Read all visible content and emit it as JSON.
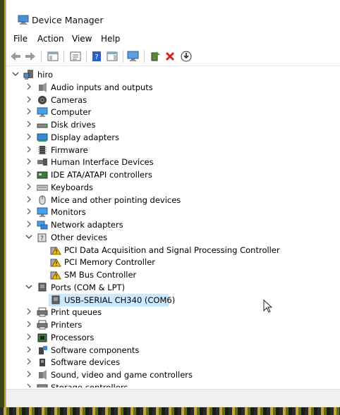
{
  "window": {
    "title": "Device Manager"
  },
  "menu": [
    "File",
    "Action",
    "View",
    "Help"
  ],
  "tree": {
    "root": "hiro",
    "rows": [
      {
        "label": "Audio inputs and outputs",
        "icon": "speaker-icon",
        "state": "collapsed"
      },
      {
        "label": "Cameras",
        "icon": "camera-icon",
        "state": "collapsed"
      },
      {
        "label": "Computer",
        "icon": "monitor-icon",
        "state": "collapsed"
      },
      {
        "label": "Disk drives",
        "icon": "disk-icon",
        "state": "collapsed"
      },
      {
        "label": "Display adapters",
        "icon": "display-adapter-icon",
        "state": "collapsed"
      },
      {
        "label": "Firmware",
        "icon": "firmware-icon",
        "state": "collapsed"
      },
      {
        "label": "Human Interface Devices",
        "icon": "hid-icon",
        "state": "collapsed"
      },
      {
        "label": "IDE ATA/ATAPI controllers",
        "icon": "ide-controller-icon",
        "state": "collapsed"
      },
      {
        "label": "Keyboards",
        "icon": "keyboard-icon",
        "state": "collapsed"
      },
      {
        "label": "Mice and other pointing devices",
        "icon": "mouse-icon",
        "state": "collapsed"
      },
      {
        "label": "Monitors",
        "icon": "monitor-icon",
        "state": "collapsed"
      },
      {
        "label": "Network adapters",
        "icon": "network-icon",
        "state": "collapsed"
      },
      {
        "label": "Other devices",
        "icon": "unknown-device-icon",
        "state": "expanded"
      },
      {
        "label": "PCI Data Acquisition and Signal Processing Controller",
        "icon": "warning-device-icon",
        "child": true
      },
      {
        "label": "PCI Memory Controller",
        "icon": "warning-device-icon",
        "child": true
      },
      {
        "label": "SM Bus Controller",
        "icon": "warning-device-icon",
        "child": true
      },
      {
        "label": "Ports (COM & LPT)",
        "icon": "port-icon",
        "state": "expanded"
      },
      {
        "label": "USB-SERIAL CH340 (COM6)",
        "icon": "port-icon",
        "child": true,
        "selected": true
      },
      {
        "label": "Print queues",
        "icon": "printer-icon",
        "state": "collapsed"
      },
      {
        "label": "Printers",
        "icon": "printer-icon",
        "state": "collapsed"
      },
      {
        "label": "Processors",
        "icon": "processor-icon",
        "state": "collapsed"
      },
      {
        "label": "Software components",
        "icon": "software-component-icon",
        "state": "collapsed"
      },
      {
        "label": "Software devices",
        "icon": "software-device-icon",
        "state": "collapsed"
      },
      {
        "label": "Sound, video and game controllers",
        "icon": "speaker-icon",
        "state": "collapsed"
      },
      {
        "label": "Storage controllers",
        "icon": "storage-icon",
        "state": "collapsed"
      }
    ]
  },
  "colors": {
    "selection": "#cce8ff",
    "warning": "#f5c400",
    "blue": "#2b6cc4"
  }
}
